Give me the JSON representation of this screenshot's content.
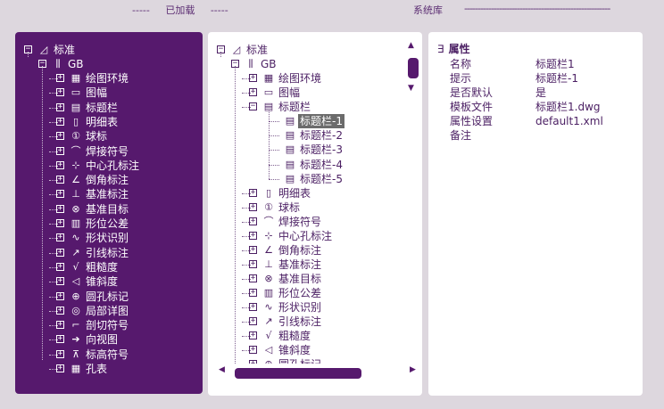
{
  "header": {
    "loaded_dashes_left": "-----",
    "loaded_title": "已加载",
    "loaded_dashes_right": "-----",
    "library_title": "系统库",
    "library_dashes": "-------------------------------------------------------"
  },
  "loaded_tree": {
    "root": {
      "label": "标准",
      "toggle": "−"
    },
    "gb": {
      "label": "GB",
      "toggle": "−"
    },
    "items": [
      {
        "label": "绘图环境",
        "icon": "grid-icon",
        "glyph": "▦"
      },
      {
        "label": "图幅",
        "icon": "frame-icon",
        "glyph": "▭"
      },
      {
        "label": "标题栏",
        "icon": "titleblock-icon",
        "glyph": "▤"
      },
      {
        "label": "明细表",
        "icon": "table-icon",
        "glyph": "▯"
      },
      {
        "label": "球标",
        "icon": "balloon-icon",
        "glyph": "①"
      },
      {
        "label": "焊接符号",
        "icon": "weld-icon",
        "glyph": "⌒"
      },
      {
        "label": "中心孔标注",
        "icon": "center-hole-icon",
        "glyph": "⊹"
      },
      {
        "label": "倒角标注",
        "icon": "chamfer-icon",
        "glyph": "∠"
      },
      {
        "label": "基准标注",
        "icon": "datum-icon",
        "glyph": "⊥"
      },
      {
        "label": "基准目标",
        "icon": "datum-target-icon",
        "glyph": "⊗"
      },
      {
        "label": "形位公差",
        "icon": "tolerance-icon",
        "glyph": "▥"
      },
      {
        "label": "形状识别",
        "icon": "shape-icon",
        "glyph": "∿"
      },
      {
        "label": "引线标注",
        "icon": "leader-icon",
        "glyph": "↗"
      },
      {
        "label": "粗糙度",
        "icon": "roughness-icon",
        "glyph": "√"
      },
      {
        "label": "锥斜度",
        "icon": "taper-icon",
        "glyph": "◁"
      },
      {
        "label": "圆孔标记",
        "icon": "round-hole-icon",
        "glyph": "⊕"
      },
      {
        "label": "局部详图",
        "icon": "detail-icon",
        "glyph": "◎"
      },
      {
        "label": "剖切符号",
        "icon": "section-icon",
        "glyph": "⌐"
      },
      {
        "label": "向视图",
        "icon": "view-arrow-icon",
        "glyph": "➔"
      },
      {
        "label": "标高符号",
        "icon": "elevation-icon",
        "glyph": "⊼"
      },
      {
        "label": "孔表",
        "icon": "hole-table-icon",
        "glyph": "▦"
      }
    ]
  },
  "library_tree": {
    "root": {
      "label": "标准",
      "toggle": "−"
    },
    "gb": {
      "label": "GB",
      "toggle": "−"
    },
    "items": [
      {
        "label": "绘图环境",
        "icon": "grid-icon",
        "glyph": "▦",
        "toggle": "+"
      },
      {
        "label": "图幅",
        "icon": "frame-icon",
        "glyph": "▭",
        "toggle": "+"
      },
      {
        "label": "标题栏",
        "icon": "titleblock-icon",
        "glyph": "▤",
        "toggle": "−",
        "children": [
          {
            "label": "标题栏-1",
            "selected": true
          },
          {
            "label": "标题栏-2"
          },
          {
            "label": "标题栏-3"
          },
          {
            "label": "标题栏-4"
          },
          {
            "label": "标题栏-5"
          }
        ]
      },
      {
        "label": "明细表",
        "icon": "table-icon",
        "glyph": "▯",
        "toggle": "+"
      },
      {
        "label": "球标",
        "icon": "balloon-icon",
        "glyph": "①",
        "toggle": "+"
      },
      {
        "label": "焊接符号",
        "icon": "weld-icon",
        "glyph": "⌒",
        "toggle": "+"
      },
      {
        "label": "中心孔标注",
        "icon": "center-hole-icon",
        "glyph": "⊹",
        "toggle": "+"
      },
      {
        "label": "倒角标注",
        "icon": "chamfer-icon",
        "glyph": "∠",
        "toggle": "+"
      },
      {
        "label": "基准标注",
        "icon": "datum-icon",
        "glyph": "⊥",
        "toggle": "+"
      },
      {
        "label": "基准目标",
        "icon": "datum-target-icon",
        "glyph": "⊗",
        "toggle": "+"
      },
      {
        "label": "形位公差",
        "icon": "tolerance-icon",
        "glyph": "▥",
        "toggle": "+"
      },
      {
        "label": "形状识别",
        "icon": "shape-icon",
        "glyph": "∿",
        "toggle": "+"
      },
      {
        "label": "引线标注",
        "icon": "leader-icon",
        "glyph": "↗",
        "toggle": "+"
      },
      {
        "label": "粗糙度",
        "icon": "roughness-icon",
        "glyph": "√",
        "toggle": "+"
      },
      {
        "label": "锥斜度",
        "icon": "taper-icon",
        "glyph": "◁",
        "toggle": "+"
      },
      {
        "label": "圆孔标记",
        "icon": "round-hole-icon",
        "glyph": "⊕",
        "toggle": "+"
      }
    ],
    "doc_glyph": "▤"
  },
  "scroll": {
    "up": "▲",
    "down": "▼",
    "left": "◀",
    "right": "▶",
    "vertical_position": 0.1,
    "horizontal_position": 0.0
  },
  "properties": {
    "collapse": "∃",
    "title": "属性",
    "rows": [
      {
        "key": "名称",
        "value": "标题栏1"
      },
      {
        "key": "提示",
        "value": "标题栏-1"
      },
      {
        "key": "是否默认",
        "value": "是"
      },
      {
        "key": "模板文件",
        "value": "标题栏1.dwg"
      },
      {
        "key": "属性设置",
        "value": "default1.xml"
      },
      {
        "key": "备注",
        "value": ""
      }
    ]
  },
  "colors": {
    "accent": "#56196d",
    "background": "#ddd7de",
    "selection": "#6b6b6b"
  }
}
